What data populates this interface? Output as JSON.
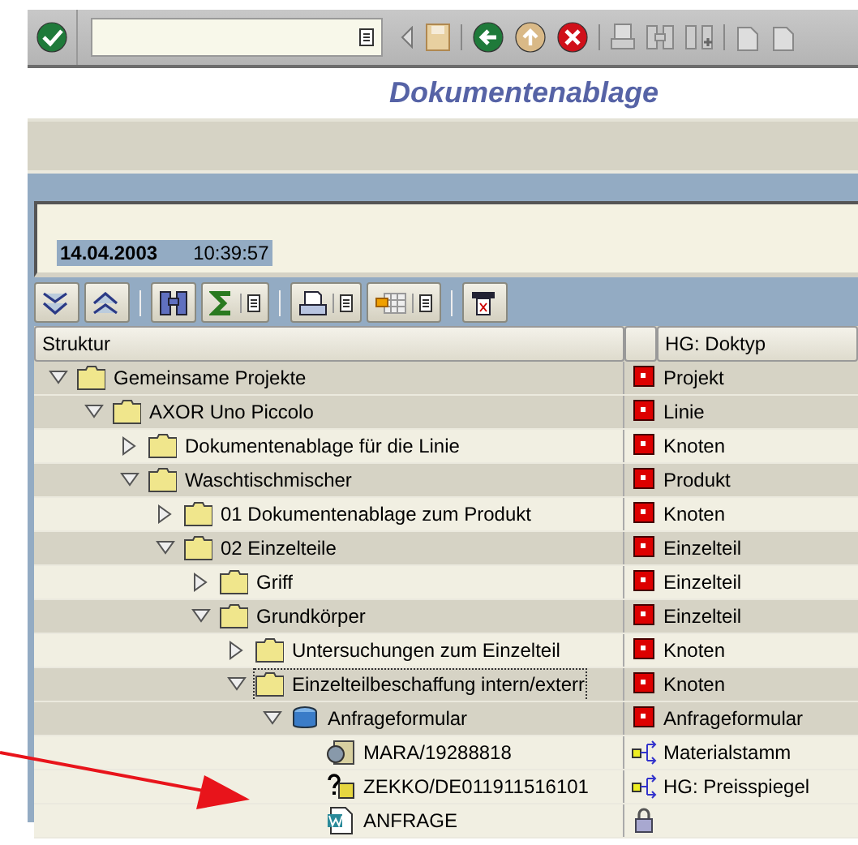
{
  "title": "Dokumentenablage",
  "report_header": {
    "date": "14.04.2003",
    "time": "10:39:57"
  },
  "columns": [
    "Struktur",
    "HG: Doktyp"
  ],
  "tree": [
    {
      "label": "Gemeinsame Projekte",
      "kind": "folder",
      "expanded": true,
      "doktyp": "Projekt",
      "focused": false,
      "children": [
        {
          "label": "AXOR Uno Piccolo",
          "kind": "folder",
          "expanded": true,
          "doktyp": "Linie",
          "focused": false,
          "children": [
            {
              "label": "Dokumentenablage für die Linie",
              "kind": "folder",
              "expanded": false,
              "doktyp": "Knoten",
              "focused": false
            },
            {
              "label": "Waschtischmischer",
              "kind": "folder",
              "expanded": true,
              "doktyp": "Produkt",
              "focused": false,
              "children": [
                {
                  "label": "01 Dokumentenablage zum Produkt",
                  "kind": "folder",
                  "expanded": false,
                  "doktyp": "Knoten",
                  "focused": false
                },
                {
                  "label": "02 Einzelteile",
                  "kind": "folder",
                  "expanded": true,
                  "doktyp": "Einzelteil",
                  "focused": false,
                  "children": [
                    {
                      "label": "Griff",
                      "kind": "folder",
                      "expanded": false,
                      "doktyp": "Einzelteil",
                      "focused": false
                    },
                    {
                      "label": "Grundkörper",
                      "kind": "folder",
                      "expanded": true,
                      "doktyp": "Einzelteil",
                      "focused": false,
                      "children": [
                        {
                          "label": "Untersuchungen zum Einzelteil",
                          "kind": "folder",
                          "expanded": false,
                          "doktyp": "Knoten",
                          "focused": false
                        },
                        {
                          "label": "Einzelteilbeschaffung intern/exterr",
                          "kind": "folder",
                          "expanded": true,
                          "doktyp": "Knoten",
                          "focused": true,
                          "children": [
                            {
                              "label": "Anfrageformular",
                              "kind": "database",
                              "expanded": true,
                              "doktyp": "Anfrageformular",
                              "focused": false,
                              "children": [
                                {
                                  "label": "MARA/19288818",
                                  "kind": "material",
                                  "doktyp": "Materialstamm",
                                  "focused": false
                                },
                                {
                                  "label": "ZEKKO/DE011911516101",
                                  "kind": "query",
                                  "doktyp": "HG: Preisspiegel",
                                  "focused": false
                                },
                                {
                                  "label": "ANFRAGE",
                                  "kind": "document",
                                  "focused": false
                                }
                              ]
                            }
                          ]
                        }
                      ]
                    }
                  ]
                }
              ]
            }
          ]
        }
      ]
    }
  ]
}
